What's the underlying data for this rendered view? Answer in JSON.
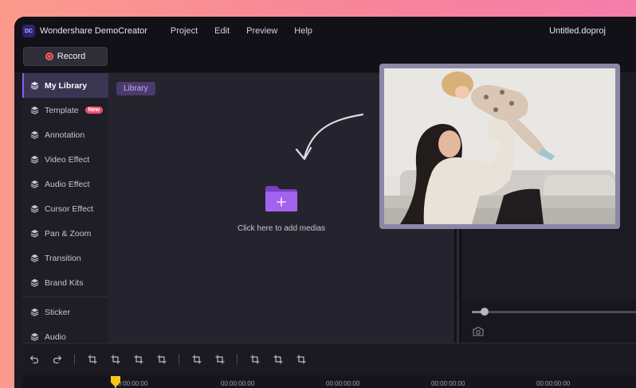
{
  "app": {
    "name": "Wondershare DemoCreator",
    "logo_text": "DC",
    "file_name": "Untitled.doproj"
  },
  "menu": [
    "Project",
    "Edit",
    "Preview",
    "Help"
  ],
  "record_button": {
    "label": "Record"
  },
  "sidebar": {
    "items": [
      {
        "label": "My Library",
        "active": true
      },
      {
        "label": "Template",
        "badge": "New"
      },
      {
        "label": "Annotation"
      },
      {
        "label": "Video Effect"
      },
      {
        "label": "Audio Effect"
      },
      {
        "label": "Cursor Effect"
      },
      {
        "label": "Pan & Zoom"
      },
      {
        "label": "Transition"
      },
      {
        "label": "Brand Kits"
      },
      {
        "label": "Sticker"
      },
      {
        "label": "Audio"
      }
    ]
  },
  "library": {
    "tag": "Library",
    "add_media_text": "Click here to add medias"
  },
  "timeline": {
    "ticks": [
      "00:00:00:00",
      "00:00:00:00",
      "00:00:00:00",
      "00:00:00:00",
      "00:00:00:00"
    ]
  },
  "colors": {
    "accent": "#8b5cf6",
    "record": "#ff5a5a",
    "badge": "#f0506e",
    "playhead": "#f5c518",
    "folder": "#9b5de5"
  }
}
